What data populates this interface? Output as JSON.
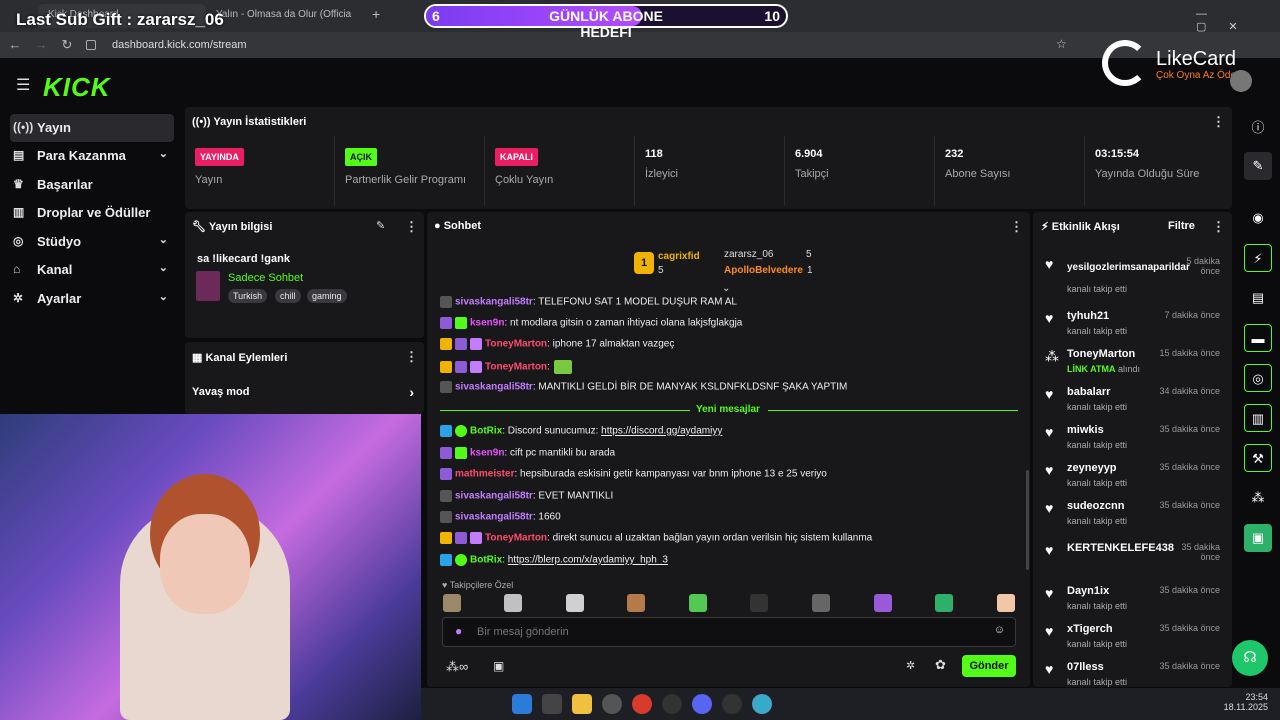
{
  "browser": {
    "tabs": [
      {
        "label": "Kick Dashboard"
      },
      {
        "label": "Yalın - Olmasa da Olur (Officia"
      }
    ],
    "url": "dashboard.kick.com/stream"
  },
  "overlay": {
    "sub_gift": "Last Sub Gift : zararsz_06",
    "goal_title": "GÜNLÜK ABONE HEDEFI",
    "goal_current": "6",
    "goal_target": "10",
    "goal_progress": 0.6,
    "brand": "LikeCard",
    "brand_tag": "Çok Oyna  Az Öde"
  },
  "sidebar": {
    "items": [
      {
        "label": "Yayın",
        "icon": "broadcast-icon"
      },
      {
        "label": "Para Kazanma",
        "icon": "money-icon"
      },
      {
        "label": "Başarılar",
        "icon": "trophy-icon"
      },
      {
        "label": "Droplar ve Ödüller",
        "icon": "gift-icon"
      },
      {
        "label": "Stüdyo",
        "icon": "studio-icon"
      },
      {
        "label": "Kanal",
        "icon": "channel-icon"
      },
      {
        "label": "Ayarlar",
        "icon": "gear-icon"
      }
    ]
  },
  "stats": {
    "title": "Yayın İstatistikleri",
    "items": [
      {
        "badge": "YAYINDA",
        "label": "Yayın"
      },
      {
        "badge": "AÇIK",
        "label": "Partnerlik Gelir Programı"
      },
      {
        "badge": "KAPALI",
        "label": "Çoklu Yayın"
      },
      {
        "value": "118",
        "label": "İzleyici"
      },
      {
        "value": "6.904",
        "label": "Takipçi"
      },
      {
        "value": "232",
        "label": "Abone Sayısı"
      },
      {
        "value": "03:15:54",
        "label": "Yayında Olduğu Süre"
      }
    ]
  },
  "stream_info": {
    "title": "Yayın bilgisi",
    "stream_title": "sa !likecard !gank",
    "category": "Sadece Sohbet",
    "tags": [
      "Turkish",
      "chill",
      "gaming"
    ]
  },
  "channel_actions": {
    "title": "Kanal Eylemleri",
    "slow_mode": "Yavaş mod"
  },
  "chat": {
    "title": "Sohbet",
    "leader": {
      "rank": "1",
      "name": "cagrixfid",
      "count": "5"
    },
    "others": [
      {
        "name": "zararsz_06",
        "count": "5"
      },
      {
        "name": "ApolloBelvedere",
        "count": "1"
      }
    ],
    "messages": [
      {
        "user": "sivaskangali58tr",
        "text": ": TELEFONU SAT 1 MODEL DUŞUR RAM AL"
      },
      {
        "user": "ksen9n",
        "text": ": nt modlara gitsin o zaman ihtiyaci olana lakjsfglakgja"
      },
      {
        "user": "ToneyMarton",
        "text": ": iphone 17 almaktan vazgeç"
      },
      {
        "user": "ToneyMarton",
        "text": ":"
      },
      {
        "user": "sivaskangali58tr",
        "text": ": MANTIKLI GELDİ BİR DE MANYAK KSLDNFKLDSNF ŞAKA YAPTIM"
      }
    ],
    "new_messages_label": "Yeni mesajlar",
    "messages_new": [
      {
        "user": "BotRix",
        "text": ": Discord sunucumuz: ",
        "link": "https://discord.gg/aydamiyy"
      },
      {
        "user": "ksen9n",
        "text": ": cift pc mantikli bu arada"
      },
      {
        "user": "mathmeister",
        "text": ": hepsiburada eskisini getir kampanyası var bnm iphone 13 e 25 veriyo"
      },
      {
        "user": "sivaskangali58tr",
        "text": ": EVET MANTIKLI"
      },
      {
        "user": "sivaskangali58tr",
        "text": ": 1660"
      },
      {
        "user": "ToneyMarton",
        "text": ": direkt sunucu al uzaktan bağlan yayın ordan verilsin hiç sistem kullanma"
      },
      {
        "user": "BotRix",
        "text": ": ",
        "link": "https://blerp.com/x/aydamiyy_hph_3"
      }
    ],
    "followers_label": "Takipçilere Özel",
    "input_placeholder": "Bir mesaj gönderin",
    "send_label": "Gönder"
  },
  "activity": {
    "title": "Etkinlik Akışı",
    "filter": "Filtre",
    "items": [
      {
        "name": "yesilgozlerimsanaparildar",
        "sub": "kanalı takip etti",
        "time": "5 dakika önce"
      },
      {
        "name": "tyhuh21",
        "sub": "kanalı takip etti",
        "time": "7 dakika önce"
      },
      {
        "name": "ToneyMarton",
        "sub_strong": "LİNK ATMA",
        "sub": " alındı",
        "time": "15 dakika önce"
      },
      {
        "name": "babalarr",
        "sub": "kanalı takip etti",
        "time": "34 dakika önce"
      },
      {
        "name": "miwkis",
        "sub": "kanalı takip etti",
        "time": "35 dakika önce"
      },
      {
        "name": "zeyneyyp",
        "sub": "kanalı takip etti",
        "time": "35 dakika önce"
      },
      {
        "name": "sudeozcnn",
        "sub": "kanalı takip etti",
        "time": "35 dakika önce"
      },
      {
        "name": "KERTENKELEFE438",
        "sub": "",
        "time": "35 dakika önce"
      },
      {
        "name": "Dayn1ix",
        "sub": "kanalı takip etti",
        "time": "35 dakika önce"
      },
      {
        "name": "xTigerch",
        "sub": "kanalı takip etti",
        "time": "35 dakika önce"
      },
      {
        "name": "07lless",
        "sub": "kanalı takip etti",
        "time": "35 dakika önce"
      }
    ]
  },
  "taskbar": {
    "time": "23:54",
    "date": "18.11.2025"
  },
  "colors": {
    "kick_green": "#53fc18",
    "live_red": "#e91e63",
    "panel": "#18181b"
  }
}
